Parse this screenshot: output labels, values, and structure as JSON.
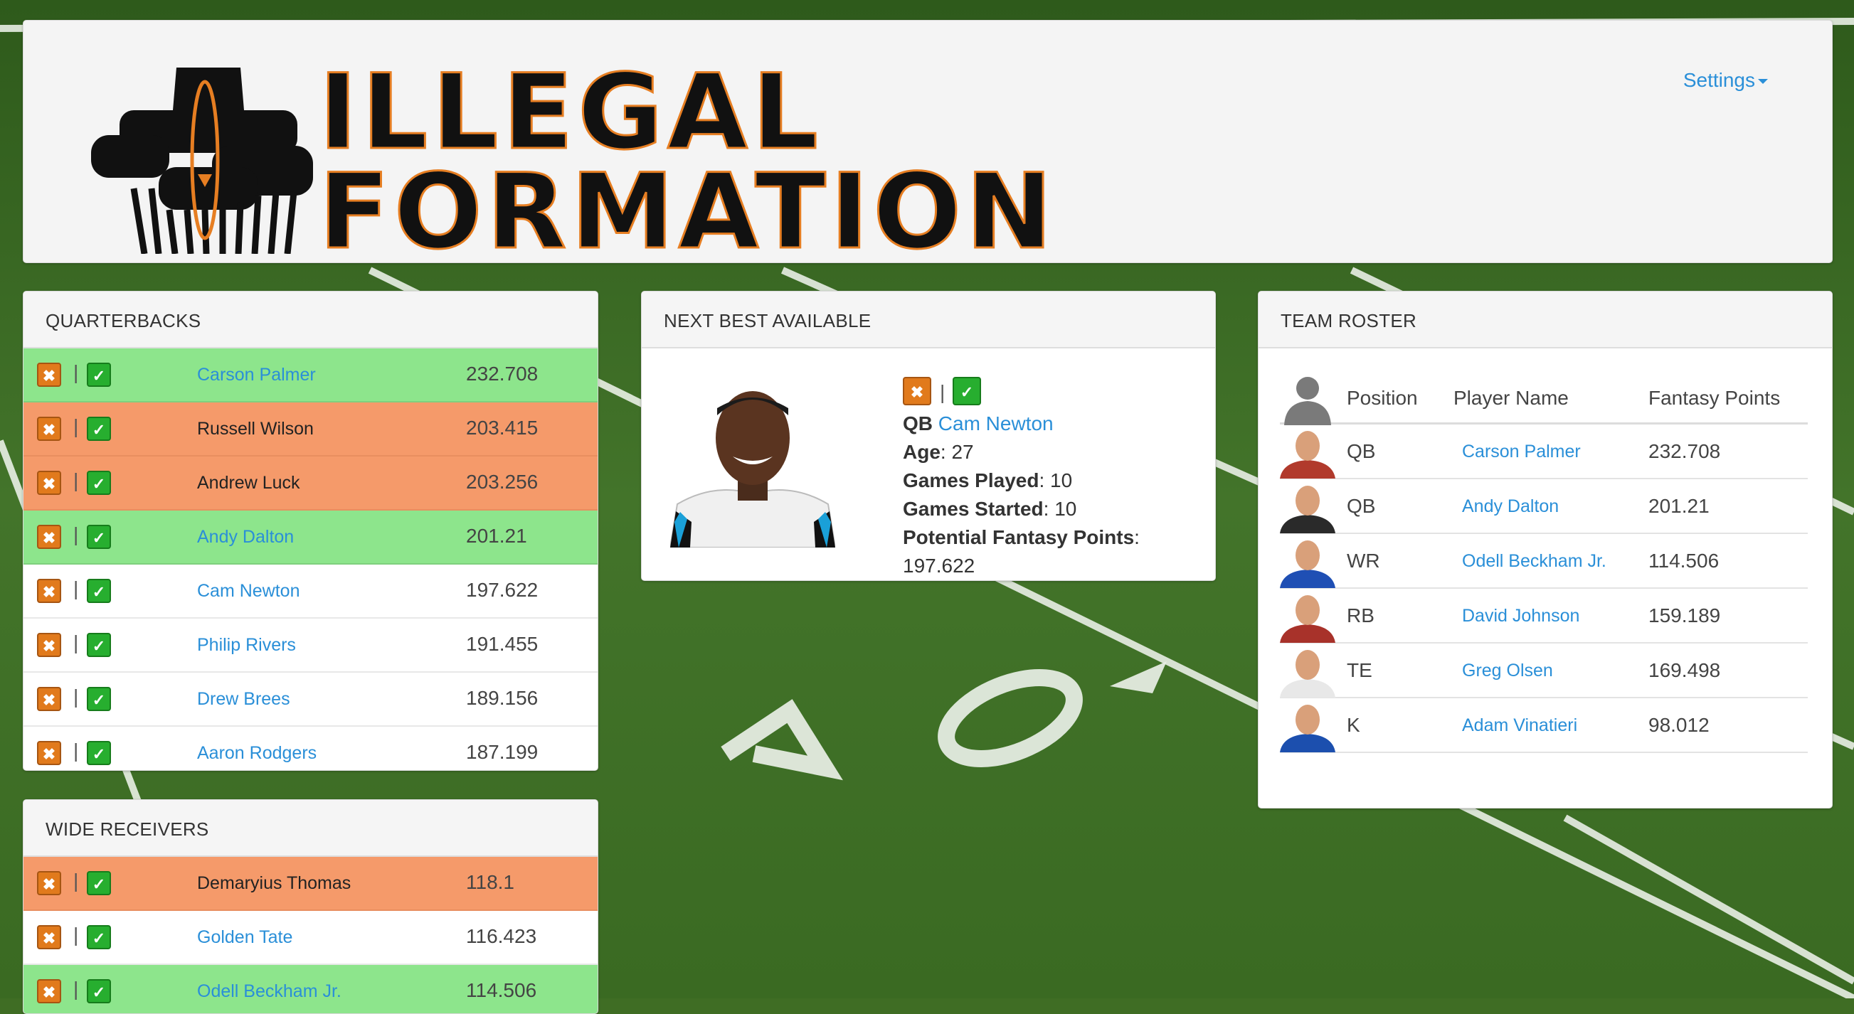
{
  "header": {
    "logo_line_1": "ILLEGAL",
    "logo_line_2": "FORMATION",
    "settings_label": "Settings"
  },
  "colors": {
    "available_green": "#8de58c",
    "drafted_orange": "#f59a6a",
    "link_blue": "#2a8fd8",
    "field_green": "#3f6d24",
    "logo_orange": "#e67e22"
  },
  "icons": {
    "reject": "x-icon",
    "accept": "check-icon"
  },
  "quarterbacks": {
    "title": "QUARTERBACKS",
    "rows": [
      {
        "name": "Carson Palmer",
        "points": "232.708",
        "status": "green"
      },
      {
        "name": "Russell Wilson",
        "points": "203.415",
        "status": "orange"
      },
      {
        "name": "Andrew Luck",
        "points": "203.256",
        "status": "orange"
      },
      {
        "name": "Andy Dalton",
        "points": "201.21",
        "status": "green"
      },
      {
        "name": "Cam Newton",
        "points": "197.622",
        "status": "white"
      },
      {
        "name": "Philip Rivers",
        "points": "191.455",
        "status": "white"
      },
      {
        "name": "Drew Brees",
        "points": "189.156",
        "status": "white"
      },
      {
        "name": "Aaron Rodgers",
        "points": "187.199",
        "status": "white"
      }
    ]
  },
  "wide_receivers": {
    "title": "WIDE RECEIVERS",
    "rows": [
      {
        "name": "Demaryius Thomas",
        "points": "118.1",
        "status": "orange"
      },
      {
        "name": "Golden Tate",
        "points": "116.423",
        "status": "white"
      },
      {
        "name": "Odell Beckham Jr.",
        "points": "114.506",
        "status": "green"
      }
    ]
  },
  "next_best": {
    "title": "NEXT BEST AVAILABLE",
    "position": "QB",
    "name": "Cam Newton",
    "age_label": "Age",
    "age": "27",
    "games_played_label": "Games Played",
    "games_played": "10",
    "games_started_label": "Games Started",
    "games_started": "10",
    "potential_label": "Potential Fantasy Points",
    "potential": "197.622"
  },
  "roster": {
    "title": "TEAM ROSTER",
    "columns": {
      "position": "Position",
      "player": "Player Name",
      "points": "Fantasy Points"
    },
    "rows": [
      {
        "position": "QB",
        "name": "Carson Palmer",
        "points": "232.708",
        "jersey": "#b13a2c"
      },
      {
        "position": "QB",
        "name": "Andy Dalton",
        "points": "201.21",
        "jersey": "#2a2a2a"
      },
      {
        "position": "WR",
        "name": "Odell Beckham Jr.",
        "points": "114.506",
        "jersey": "#1f4fb4"
      },
      {
        "position": "RB",
        "name": "David Johnson",
        "points": "159.189",
        "jersey": "#a8322a"
      },
      {
        "position": "TE",
        "name": "Greg Olsen",
        "points": "169.498",
        "jersey": "#e8e8e8"
      },
      {
        "position": "K",
        "name": "Adam Vinatieri",
        "points": "98.012",
        "jersey": "#1c4fae"
      }
    ]
  }
}
